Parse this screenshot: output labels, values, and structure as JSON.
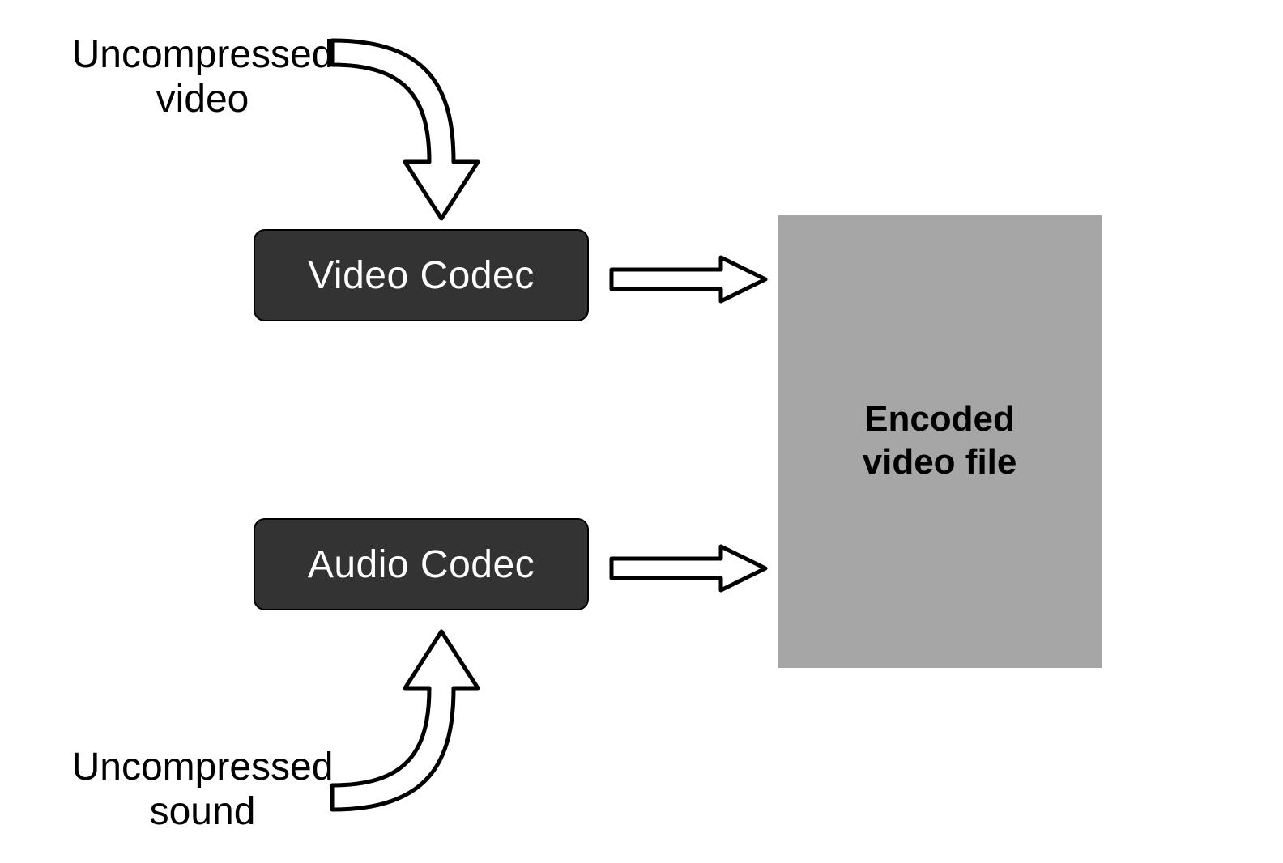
{
  "labels": {
    "input_video_line1": "Uncompressed",
    "input_video_line2": "video",
    "input_audio_line1": "Uncompressed",
    "input_audio_line2": "sound",
    "output_line1": "Encoded",
    "output_line2": "video file"
  },
  "boxes": {
    "video_codec": "Video Codec",
    "audio_codec": "Audio Codec"
  },
  "colors": {
    "codec_bg": "#333333",
    "output_bg": "#a6a6a6",
    "stroke": "#000000"
  }
}
